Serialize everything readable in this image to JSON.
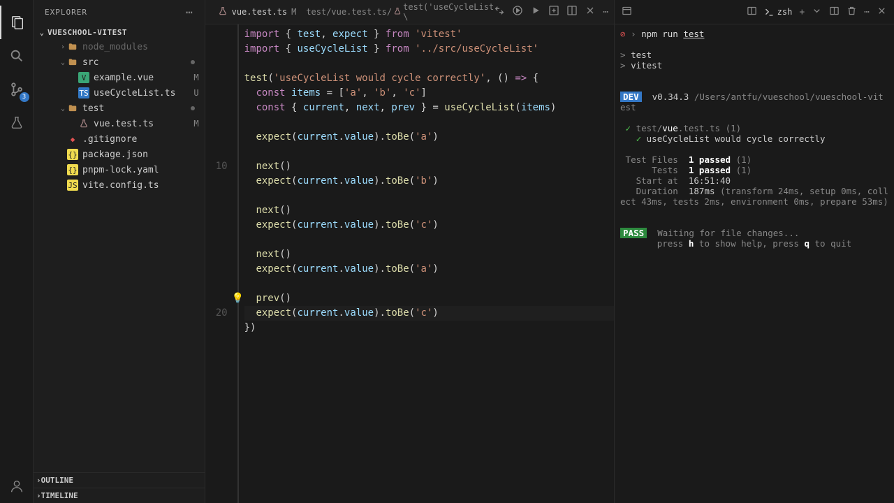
{
  "sidebar": {
    "title": "EXPLORER",
    "project": "VUESCHOOL-VITEST",
    "items": [
      {
        "name": "node_modules",
        "type": "folder",
        "indent": 2,
        "dim": true,
        "chev": "›"
      },
      {
        "name": "src",
        "type": "folder",
        "indent": 2,
        "chev": "⌄",
        "dot": true
      },
      {
        "name": "example.vue",
        "type": "vue",
        "indent": 3,
        "status": "M"
      },
      {
        "name": "useCycleList.ts",
        "type": "ts",
        "indent": 3,
        "status": "U"
      },
      {
        "name": "test",
        "type": "folder",
        "indent": 2,
        "chev": "⌄",
        "dot": true
      },
      {
        "name": "vue.test.ts",
        "type": "flask",
        "indent": 3,
        "status": "M"
      },
      {
        "name": ".gitignore",
        "type": "git",
        "indent": 2
      },
      {
        "name": "package.json",
        "type": "json",
        "indent": 2
      },
      {
        "name": "pnpm-lock.yaml",
        "type": "json",
        "indent": 2
      },
      {
        "name": "vite.config.ts",
        "type": "js",
        "indent": 2
      }
    ],
    "outline": "OUTLINE",
    "timeline": "TIMELINE"
  },
  "tab": {
    "filename": "vue.test.ts",
    "status": "M",
    "breadcrumb1": "test/vue.test.ts/",
    "breadcrumb2": "test('useCycleList \\"
  },
  "editor": {
    "gutter_10": "10",
    "gutter_20": "20",
    "lines": [
      [
        {
          "c": "kw",
          "t": "import"
        },
        {
          "c": "pun",
          "t": " { "
        },
        {
          "c": "id",
          "t": "test"
        },
        {
          "c": "pun",
          "t": ", "
        },
        {
          "c": "id",
          "t": "expect"
        },
        {
          "c": "pun",
          "t": " } "
        },
        {
          "c": "kw",
          "t": "from"
        },
        {
          "c": "pun",
          "t": " "
        },
        {
          "c": "str",
          "t": "'vitest'"
        }
      ],
      [
        {
          "c": "kw",
          "t": "import"
        },
        {
          "c": "pun",
          "t": " { "
        },
        {
          "c": "id",
          "t": "useCycleList"
        },
        {
          "c": "pun",
          "t": " } "
        },
        {
          "c": "kw",
          "t": "from"
        },
        {
          "c": "pun",
          "t": " "
        },
        {
          "c": "str",
          "t": "'../src/useCycleList'"
        }
      ],
      [],
      [
        {
          "c": "fn",
          "t": "test"
        },
        {
          "c": "pun",
          "t": "("
        },
        {
          "c": "str",
          "t": "'useCycleList would cycle correctly'"
        },
        {
          "c": "pun",
          "t": ", () "
        },
        {
          "c": "kw",
          "t": "=>"
        },
        {
          "c": "pun",
          "t": " {"
        }
      ],
      [
        {
          "c": "pun",
          "t": "  "
        },
        {
          "c": "kw",
          "t": "const"
        },
        {
          "c": "pun",
          "t": " "
        },
        {
          "c": "id",
          "t": "items"
        },
        {
          "c": "pun",
          "t": " = ["
        },
        {
          "c": "str",
          "t": "'a'"
        },
        {
          "c": "pun",
          "t": ", "
        },
        {
          "c": "str",
          "t": "'b'"
        },
        {
          "c": "pun",
          "t": ", "
        },
        {
          "c": "str",
          "t": "'c'"
        },
        {
          "c": "pun",
          "t": "]"
        }
      ],
      [
        {
          "c": "pun",
          "t": "  "
        },
        {
          "c": "kw",
          "t": "const"
        },
        {
          "c": "pun",
          "t": " { "
        },
        {
          "c": "id",
          "t": "current"
        },
        {
          "c": "pun",
          "t": ", "
        },
        {
          "c": "id",
          "t": "next"
        },
        {
          "c": "pun",
          "t": ", "
        },
        {
          "c": "id",
          "t": "prev"
        },
        {
          "c": "pun",
          "t": " } = "
        },
        {
          "c": "fn",
          "t": "useCycleList"
        },
        {
          "c": "pun",
          "t": "("
        },
        {
          "c": "id",
          "t": "items"
        },
        {
          "c": "pun",
          "t": ")"
        }
      ],
      [],
      [
        {
          "c": "pun",
          "t": "  "
        },
        {
          "c": "fn",
          "t": "expect"
        },
        {
          "c": "pun",
          "t": "("
        },
        {
          "c": "id",
          "t": "current"
        },
        {
          "c": "pun",
          "t": "."
        },
        {
          "c": "prop",
          "t": "value"
        },
        {
          "c": "pun",
          "t": ")."
        },
        {
          "c": "fn",
          "t": "toBe"
        },
        {
          "c": "pun",
          "t": "("
        },
        {
          "c": "str",
          "t": "'a'"
        },
        {
          "c": "pun",
          "t": ")"
        }
      ],
      [],
      [
        {
          "c": "pun",
          "t": "  "
        },
        {
          "c": "fn",
          "t": "next"
        },
        {
          "c": "pun",
          "t": "()"
        }
      ],
      [
        {
          "c": "pun",
          "t": "  "
        },
        {
          "c": "fn",
          "t": "expect"
        },
        {
          "c": "pun",
          "t": "("
        },
        {
          "c": "id",
          "t": "current"
        },
        {
          "c": "pun",
          "t": "."
        },
        {
          "c": "prop",
          "t": "value"
        },
        {
          "c": "pun",
          "t": ")."
        },
        {
          "c": "fn",
          "t": "toBe"
        },
        {
          "c": "pun",
          "t": "("
        },
        {
          "c": "str",
          "t": "'b'"
        },
        {
          "c": "pun",
          "t": ")"
        }
      ],
      [],
      [
        {
          "c": "pun",
          "t": "  "
        },
        {
          "c": "fn",
          "t": "next"
        },
        {
          "c": "pun",
          "t": "()"
        }
      ],
      [
        {
          "c": "pun",
          "t": "  "
        },
        {
          "c": "fn",
          "t": "expect"
        },
        {
          "c": "pun",
          "t": "("
        },
        {
          "c": "id",
          "t": "current"
        },
        {
          "c": "pun",
          "t": "."
        },
        {
          "c": "prop",
          "t": "value"
        },
        {
          "c": "pun",
          "t": ")."
        },
        {
          "c": "fn",
          "t": "toBe"
        },
        {
          "c": "pun",
          "t": "("
        },
        {
          "c": "str",
          "t": "'c'"
        },
        {
          "c": "pun",
          "t": ")"
        }
      ],
      [],
      [
        {
          "c": "pun",
          "t": "  "
        },
        {
          "c": "fn",
          "t": "next"
        },
        {
          "c": "pun",
          "t": "()"
        }
      ],
      [
        {
          "c": "pun",
          "t": "  "
        },
        {
          "c": "fn",
          "t": "expect"
        },
        {
          "c": "pun",
          "t": "("
        },
        {
          "c": "id",
          "t": "current"
        },
        {
          "c": "pun",
          "t": "."
        },
        {
          "c": "prop",
          "t": "value"
        },
        {
          "c": "pun",
          "t": ")."
        },
        {
          "c": "fn",
          "t": "toBe"
        },
        {
          "c": "pun",
          "t": "("
        },
        {
          "c": "str",
          "t": "'a'"
        },
        {
          "c": "pun",
          "t": ")"
        }
      ],
      [],
      [
        {
          "c": "pun",
          "t": "  "
        },
        {
          "c": "fn",
          "t": "prev"
        },
        {
          "c": "pun",
          "t": "()"
        }
      ],
      [
        {
          "c": "pun",
          "t": "  "
        },
        {
          "c": "fn",
          "t": "expect"
        },
        {
          "c": "pun",
          "t": "("
        },
        {
          "c": "id",
          "t": "current"
        },
        {
          "c": "pun",
          "t": "."
        },
        {
          "c": "prop",
          "t": "value"
        },
        {
          "c": "pun",
          "t": ")."
        },
        {
          "c": "fn",
          "t": "toBe"
        },
        {
          "c": "pun",
          "t": "("
        },
        {
          "c": "str",
          "t": "'c'"
        },
        {
          "c": "pun",
          "t": ")"
        }
      ],
      [
        {
          "c": "pun",
          "t": "})"
        }
      ]
    ]
  },
  "terminal": {
    "shell": "zsh",
    "prompt_cmd": "npm run ",
    "prompt_cmd2": "test",
    "script1": "test",
    "script2": "vitest",
    "dev_badge": "DEV",
    "version": "v0.34.3",
    "path": "/Users/antfu/vueschool/vueschool-vitest",
    "check1": "✓",
    "check2": "✓",
    "file_prefix": "test/",
    "file_hl": "vue",
    "file_suffix": ".test.ts",
    "file_count": "(1)",
    "test_name": "useCycleList would cycle correctly",
    "label_testfiles": "Test Files",
    "label_tests": "Tests",
    "passed_1": "1 passed",
    "passed_count": "(1)",
    "label_start": "Start at",
    "start_time": "16:51:40",
    "label_duration": "Duration",
    "duration": "187ms",
    "duration_detail": "(transform 24ms, setup 0ms, collect 43ms, tests 2ms, environment 0ms, prepare 53ms)",
    "pass_badge": "PASS",
    "waiting": "Waiting for file changes...",
    "hint_press1": "press ",
    "hint_key1": "h",
    "hint_mid": " to show help, press ",
    "hint_key2": "q",
    "hint_end": " to quit"
  }
}
